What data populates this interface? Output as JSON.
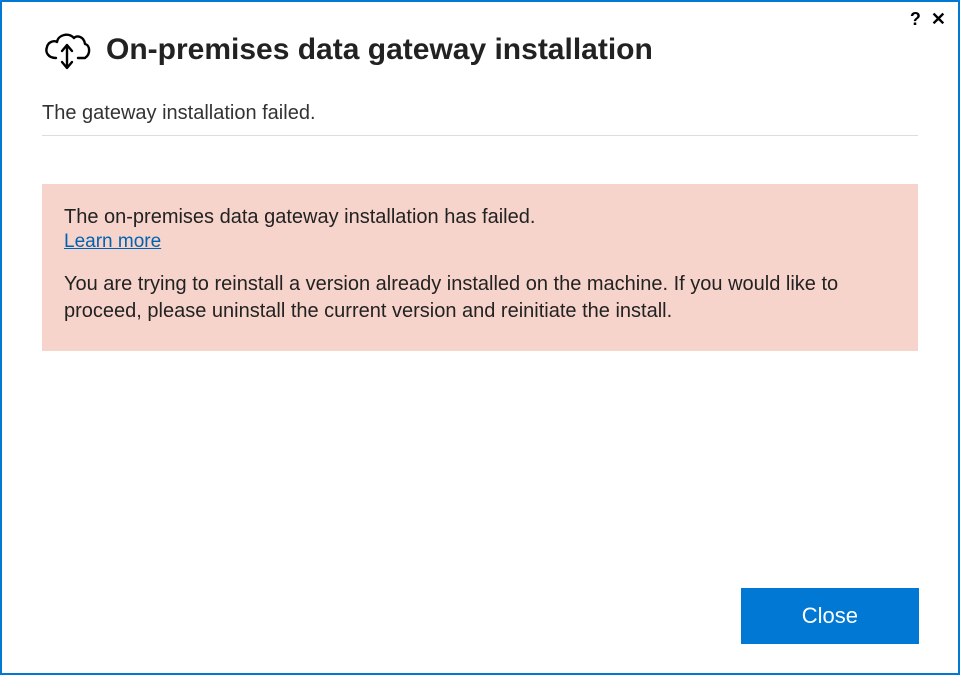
{
  "window": {
    "title": "On-premises data gateway installation"
  },
  "titlebar": {
    "help_glyph": "?",
    "close_glyph": "✕"
  },
  "status": {
    "message": "The gateway installation failed."
  },
  "error": {
    "heading": "The on-premises data gateway installation has failed.",
    "learn_more_label": "Learn more",
    "detail": "You are trying to reinstall a version already installed on the machine. If you would like to proceed, please uninstall the current version and reinitiate the install."
  },
  "footer": {
    "close_label": "Close"
  },
  "colors": {
    "accent": "#0078d4",
    "error_bg": "#f7d4cb",
    "link": "#0062b1"
  }
}
